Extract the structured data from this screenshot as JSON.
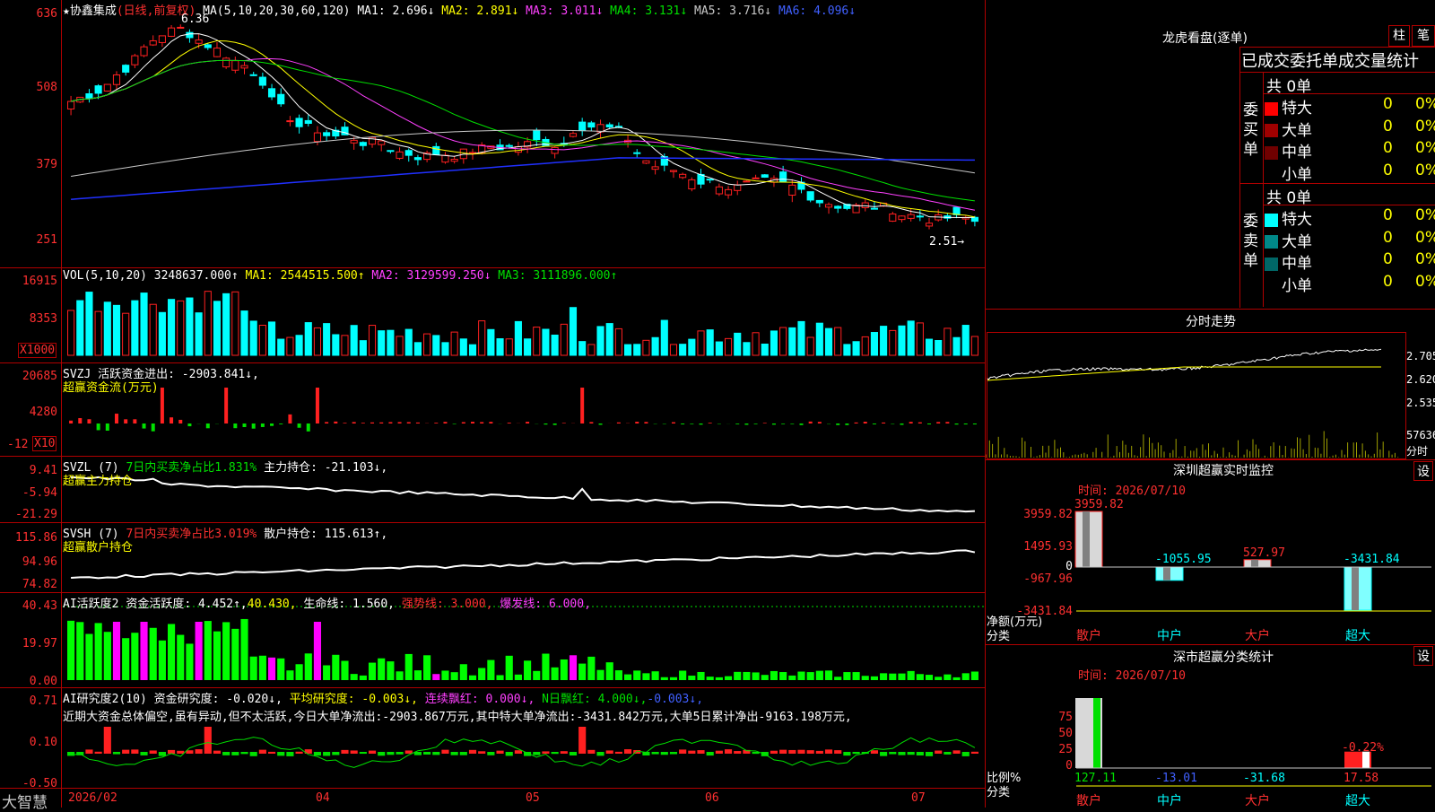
{
  "app": {
    "brand": "大智慧"
  },
  "stock": {
    "title": "★协鑫集成",
    "mode": "(日线,前复权)"
  },
  "main": {
    "ma_header": "MA(5,10,20,30,60,120)",
    "ma": [
      {
        "label": "MA1:",
        "val": "2.696↓",
        "color": "#ffffff"
      },
      {
        "label": "MA2:",
        "val": "2.891↓",
        "color": "#ffff00"
      },
      {
        "label": "MA3:",
        "val": "3.011↓",
        "color": "#ff40ff"
      },
      {
        "label": "MA4:",
        "val": "3.131↓",
        "color": "#00e000"
      },
      {
        "label": "MA5:",
        "val": "3.716↓",
        "color": "#c8c8c8"
      },
      {
        "label": "MA6:",
        "val": "4.096↓",
        "color": "#4060ff"
      }
    ],
    "axis": [
      "636",
      "508",
      "379",
      "251"
    ],
    "high_label": "6.36",
    "low_label": "2.51→"
  },
  "vol": {
    "header": "VOL(5,10,20)",
    "val": "3248637.000↑",
    "ma1": "MA1: 2544515.500↑",
    "ma2": "MA2: 3129599.250↓",
    "ma3": "MA3: 3111896.000↑",
    "axis": [
      "16915",
      "8353"
    ],
    "unit": "X1000"
  },
  "svzj": {
    "header": "SVZJ",
    "sub": "活跃资金进出: -2903.841↓,",
    "title": "超赢资金流(万元)",
    "axis": [
      "20685",
      "4280",
      "-12"
    ],
    "unit": "X10"
  },
  "svzl": {
    "header": "SVZL (7)",
    "p1": "7日内买卖净占比1.831%",
    "p2": "主力持仓: -21.103↓,",
    "title": "超赢主力持仓",
    "axis": [
      "9.41",
      "-5.94",
      "-21.29"
    ]
  },
  "svsh": {
    "header": "SVSH (7)",
    "p1": "7日内买卖净占比3.019%",
    "p2": "散户持仓: 115.613↑,",
    "title": "超赢散户持仓",
    "axis": [
      "115.86",
      "94.96",
      "74.82"
    ]
  },
  "ai1": {
    "header": "AI活跃度2",
    "p1": "资金活跃度: 4.452↑,",
    "p2": "40.430,",
    "p3": "生命线: 1.560,",
    "p4": "强势线: 3.000,",
    "p5": "爆发线: 6.000,",
    "axis": [
      "40.43",
      "19.97",
      "0.00"
    ]
  },
  "ai2": {
    "header": "AI研究度2(10)",
    "p1": "资金研究度: -0.020↓,",
    "p2": "平均研究度: -0.003↓,",
    "p3": "连续飘红: 0.000↓,",
    "p4": "N日飘红: 4.000↓,",
    "p5": "-0.003↓,",
    "note": "近期大资金总体偏空,虽有异动,但不太活跃,今日大单净流出:-2903.867万元,其中特大单净流出:-3431.842万元,大单5日累计净出-9163.198万元,",
    "axis": [
      "0.71",
      "0.10",
      "-0.50"
    ]
  },
  "xaxis": [
    "2026/02",
    "04",
    "05",
    "06",
    "07"
  ],
  "lhb": {
    "title": "龙虎看盘(逐单)",
    "btn1": "柱",
    "btn2": "笔",
    "head": "已成交委托单成交量统计",
    "buy": {
      "side": [
        "委",
        "买",
        "单"
      ],
      "total": "共 0单",
      "rows": [
        {
          "name": "特大",
          "v": "0",
          "p": "0%",
          "color": "#ff0000"
        },
        {
          "name": "大单",
          "v": "0",
          "p": "0%",
          "color": "#a00000"
        },
        {
          "name": "中单",
          "v": "0",
          "p": "0%",
          "color": "#700000"
        },
        {
          "name": "小单",
          "v": "0",
          "p": "0%",
          "color": "#000000"
        }
      ]
    },
    "sell": {
      "side": [
        "委",
        "卖",
        "单"
      ],
      "total": "共 0单",
      "rows": [
        {
          "name": "特大",
          "v": "0",
          "p": "0%",
          "color": "#00ffff"
        },
        {
          "name": "大单",
          "v": "0",
          "p": "0%",
          "color": "#008888"
        },
        {
          "name": "中单",
          "v": "0",
          "p": "0%",
          "color": "#006666"
        },
        {
          "name": "小单",
          "v": "0",
          "p": "0%",
          "color": "#000000"
        }
      ]
    }
  },
  "fs": {
    "title": "分时走势",
    "axis": [
      "2.705",
      "2.620",
      "2.535",
      "57636",
      "分时"
    ]
  },
  "sz": {
    "title": "深圳超赢实时监控",
    "btn": "设",
    "time": "时间: 2026/07/10",
    "axis": [
      "3959.82",
      "1495.93",
      "0",
      "-967.96",
      "-3431.84"
    ],
    "ylabel": "净额(万元)",
    "xlabel": "分类",
    "cats": [
      "散户",
      "中户",
      "大户",
      "超大"
    ],
    "vals": [
      "3959.82",
      "-1055.95",
      "527.97",
      "-3431.84"
    ],
    "nums": [
      3959.82,
      -1055.95,
      527.97,
      -3431.84
    ]
  },
  "ss": {
    "title": "深市超赢分类统计",
    "btn": "设",
    "time": "时间: 2026/07/10",
    "axis": [
      "75",
      "50",
      "25",
      "0"
    ],
    "ylabel": "比例%",
    "xlabel": "分类",
    "cats": [
      "散户",
      "中户",
      "大户",
      "超大"
    ],
    "vals": [
      "127.11",
      "-13.01",
      "-31.68",
      "17.58"
    ],
    "top": "-0.22%"
  },
  "chart_data": [
    {
      "type": "bar",
      "title": "深圳超赢实时监控",
      "categories": [
        "散户",
        "中户",
        "大户",
        "超大"
      ],
      "values": [
        3959.82,
        -1055.95,
        527.97,
        -3431.84
      ],
      "ylabel": "净额(万元)",
      "xlabel": "分类",
      "ylim": [
        -3431.84,
        3959.82
      ]
    },
    {
      "type": "bar",
      "title": "深市超赢分类统计",
      "categories": [
        "散户",
        "中户",
        "大户",
        "超大"
      ],
      "values": [
        127.11,
        -13.01,
        -31.68,
        17.58
      ],
      "ylabel": "比例%",
      "xlabel": "分类",
      "ylim": [
        0,
        75
      ]
    }
  ]
}
